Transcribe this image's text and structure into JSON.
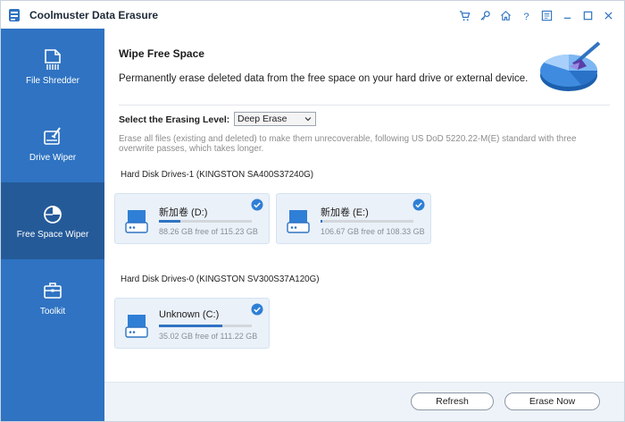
{
  "window": {
    "title": "Coolmuster Data Erasure"
  },
  "titlebar_icons": [
    "cart-icon",
    "key-icon",
    "home-icon",
    "help-icon",
    "feedback-icon",
    "minimize-icon",
    "maximize-icon",
    "close-icon"
  ],
  "sidebar": {
    "items": [
      {
        "label": "File Shredder",
        "icon": "file-shredder-icon",
        "active": false
      },
      {
        "label": "Drive Wiper",
        "icon": "drive-wiper-icon",
        "active": false
      },
      {
        "label": "Free Space Wiper",
        "icon": "pie-icon",
        "active": true
      },
      {
        "label": "Toolkit",
        "icon": "toolkit-icon",
        "active": false
      }
    ]
  },
  "main": {
    "title": "Wipe Free Space",
    "description": "Permanently erase deleted data from the free space on your hard drive or external device.",
    "erasing_level_label": "Select the Erasing Level:",
    "erasing_level_value": "Deep Erase",
    "erasing_level_note": "Erase all files (existing and deleted) to make them unrecoverable, following US DoD 5220.22-M(E) standard with three overwrite passes, which takes longer.",
    "groups": [
      {
        "title": "Hard Disk Drives-1 (KINGSTON SA400S37240G)",
        "drives": [
          {
            "name": "新加卷 (D:)",
            "free_text": "88.26 GB free of 115.23 GB",
            "used_fraction": 0.234,
            "checked": true
          },
          {
            "name": "新加卷 (E:)",
            "free_text": "106.67 GB free of 108.33 GB",
            "used_fraction": 0.015,
            "checked": true
          }
        ]
      },
      {
        "title": "Hard Disk Drives-0 (KINGSTON SV300S37A120G)",
        "drives": [
          {
            "name": "Unknown (C:)",
            "free_text": "35.02 GB free of 111.22 GB",
            "used_fraction": 0.685,
            "checked": true
          }
        ]
      }
    ]
  },
  "footer": {
    "refresh_label": "Refresh",
    "erase_label": "Erase Now"
  },
  "colors": {
    "accent": "#2f73c2",
    "sidebar_active": "#255a99",
    "card_bg": "#eaf1f9"
  }
}
